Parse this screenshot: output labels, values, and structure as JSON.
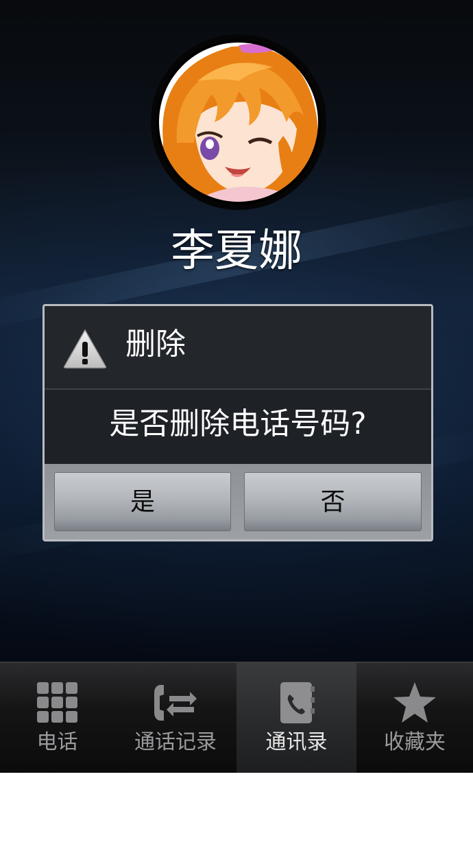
{
  "contact": {
    "name": "李夏娜",
    "avatar_icon": "anime-girl-avatar"
  },
  "dialog": {
    "icon": "warning-icon",
    "title": "删除",
    "message": "是否删除电话号码?",
    "buttons": {
      "yes_label": "是",
      "no_label": "否"
    }
  },
  "tabbar": {
    "active_tab": "通讯录",
    "tabs": [
      {
        "label": "电话",
        "icon": "dialpad-icon"
      },
      {
        "label": "通话记录",
        "icon": "call-log-icon"
      },
      {
        "label": "通讯录",
        "icon": "contacts-book-icon"
      },
      {
        "label": "收藏夹",
        "icon": "star-icon"
      }
    ]
  },
  "colors": {
    "background_dark": "#0b1119",
    "background_blue": "#13243a",
    "dialog_border": "#b9bcc0",
    "button_gray": "#b3b7bc",
    "avatar_hair": "#f08a1c"
  }
}
